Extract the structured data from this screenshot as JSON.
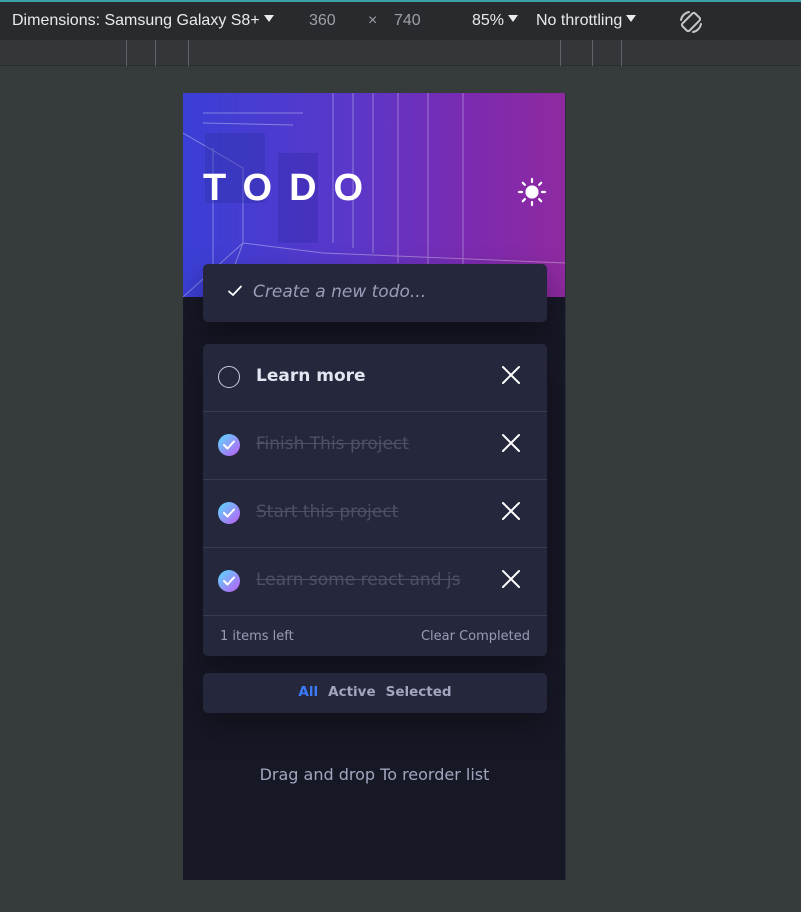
{
  "devtools": {
    "dimensions_label": "Dimensions: Samsung Galaxy S8+",
    "width": "360",
    "times": "×",
    "height": "740",
    "zoom": "85%",
    "throttling": "No throttling",
    "rotate_icon": "rotate-icon"
  },
  "app": {
    "title": "TODO",
    "theme_icon": "sun-icon",
    "create": {
      "placeholder": "Create a new todo...",
      "value": ""
    },
    "todos": [
      {
        "text": "Learn more",
        "completed": false
      },
      {
        "text": "Finish This project",
        "completed": true
      },
      {
        "text": "Start this project",
        "completed": true
      },
      {
        "text": "Learn some react and js",
        "completed": true
      }
    ],
    "footer": {
      "items_left": "1 items left",
      "clear_completed": "Clear Completed"
    },
    "filters": {
      "all": "All",
      "active": "Active",
      "selected": "Selected",
      "current": "All"
    },
    "hint": "Drag and drop To reorder list"
  },
  "colors": {
    "accent": "#3a7cfd",
    "check_gradient_start": "#57ddff",
    "check_gradient_end": "#c058f3",
    "card": "#25273c",
    "background": "#171826"
  }
}
